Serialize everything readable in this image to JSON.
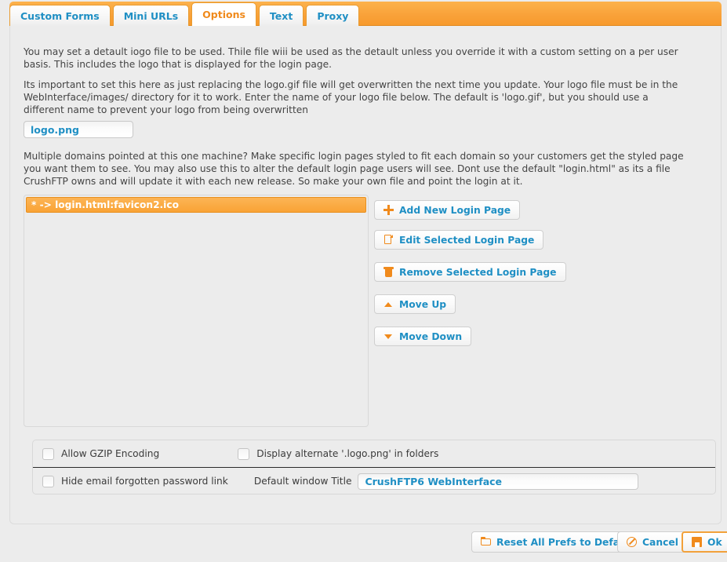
{
  "tabs": [
    {
      "label": "Custom Forms",
      "active": false
    },
    {
      "label": "Mini URLs",
      "active": false
    },
    {
      "label": "Options",
      "active": true
    },
    {
      "label": "Text",
      "active": false
    },
    {
      "label": "Proxy",
      "active": false
    }
  ],
  "paragraphs": {
    "logo_intro": "You may set a detault iogo file to be used. Thile file wiii be used as the detault unless you override it with a custom setting on a per user basis. This includes the logo that is displayed for the login page.",
    "logo_warning": "Its important to set this here as just replacing the logo.gif file will get overwritten the next time you update. Your logo file must be in the WebInterface/images/ directory for it to work. Enter the name of your logo file below. The default is 'logo.gif', but you should use a different name to prevent your logo from being overwritten",
    "domains": "Multiple domains pointed at this one machine? Make specific login pages styled to fit each domain so your customers get the styled page you want them to see. You may also use this to alter the default login page users will see. Dont use the default \"login.html\" as its a file CrushFTP owns and will update it with each new release. So make your own file and point the login at it."
  },
  "logo_field": {
    "value": "logo.png",
    "placeholder": "logo.gif"
  },
  "login_pages": {
    "items": [
      {
        "label": "* -> login.html:favicon2.ico",
        "selected": true
      }
    ]
  },
  "side_buttons": [
    {
      "label": "Add New Login Page",
      "icon": "plus-icon"
    },
    {
      "label": "Edit Selected Login Page",
      "icon": "document-icon"
    },
    {
      "label": "Remove Selected Login Page",
      "icon": "trash-icon"
    },
    {
      "label": "Move Up",
      "icon": "triangle-up-icon"
    },
    {
      "label": "Move Down",
      "icon": "triangle-down-icon"
    }
  ],
  "options": {
    "gzip": {
      "label": "Allow GZIP Encoding",
      "checked": false
    },
    "alternate_logo": {
      "label": "Display alternate '.logo.png' in folders",
      "checked": false
    },
    "hide_forgotten": {
      "label": "Hide email forgotten password link",
      "checked": false
    },
    "window_title": {
      "label": "Default window Title",
      "value": "CrushFTP6 WebInterface",
      "placeholder": "CrushFTP6 WebInterface"
    }
  },
  "footer": {
    "reset": {
      "label": "Reset All Prefs to Default",
      "icon": "folder-icon"
    },
    "cancel": {
      "label": "Cancel",
      "icon": "cancel-icon"
    },
    "ok": {
      "label": "Ok",
      "icon": "save-icon"
    }
  },
  "colors": {
    "accent_orange": "#f08a1c",
    "link_blue": "#1f8fc4",
    "header_orange": "#f9a23a",
    "page_bg": "#ececec"
  }
}
